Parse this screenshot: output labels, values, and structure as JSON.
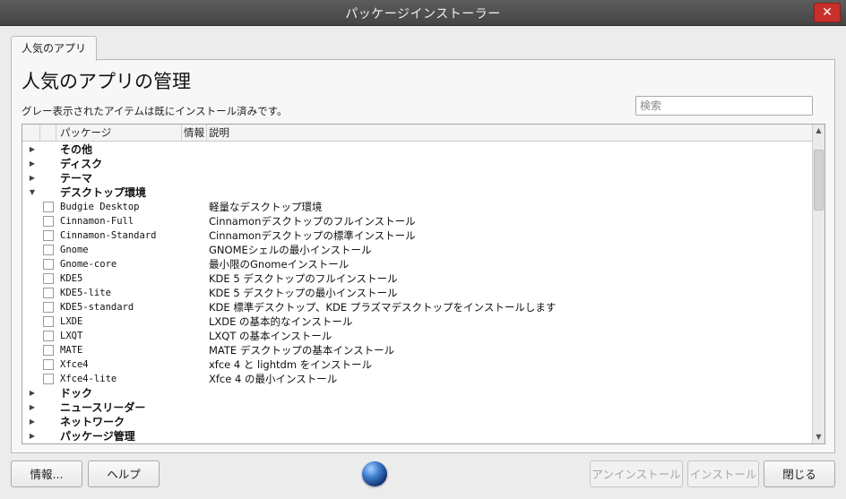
{
  "window": {
    "title": "パッケージインストーラー",
    "close_label": "✕"
  },
  "tab": {
    "label": "人気のアプリ"
  },
  "main": {
    "heading": "人気のアプリの管理",
    "subtext": "グレー表示されたアイテムは既にインストール済みです。",
    "search_placeholder": "検索"
  },
  "table": {
    "columns": [
      "パッケージ",
      "情報",
      "説明"
    ],
    "rows": [
      {
        "type": "category",
        "label": "その他",
        "expanded": false
      },
      {
        "type": "category",
        "label": "ディスク",
        "expanded": false
      },
      {
        "type": "category",
        "label": "テーマ",
        "expanded": false
      },
      {
        "type": "category",
        "label": "デスクトップ環境",
        "expanded": true
      },
      {
        "type": "package",
        "name": "Budgie Desktop",
        "desc": "軽量なデスクトップ環境",
        "checked": false
      },
      {
        "type": "package",
        "name": "Cinnamon-Full",
        "desc": "Cinnamonデスクトップのフルインストール",
        "checked": false
      },
      {
        "type": "package",
        "name": "Cinnamon-Standard",
        "desc": "Cinnamonデスクトップの標準インストール",
        "checked": false
      },
      {
        "type": "package",
        "name": "Gnome",
        "desc": "GNOMEシェルの最小インストール",
        "checked": false
      },
      {
        "type": "package",
        "name": "Gnome-core",
        "desc": "最小限のGnomeインストール",
        "checked": false
      },
      {
        "type": "package",
        "name": "KDE5",
        "desc": "KDE 5 デスクトップのフルインストール",
        "checked": false
      },
      {
        "type": "package",
        "name": "KDE5-lite",
        "desc": "KDE 5 デスクトップの最小インストール",
        "checked": false
      },
      {
        "type": "package",
        "name": "KDE5-standard",
        "desc": "KDE 標準デスクトップ、KDE プラズマデスクトップをインストールします",
        "checked": false
      },
      {
        "type": "package",
        "name": "LXDE",
        "desc": "LXDE の基本的なインストール",
        "checked": false
      },
      {
        "type": "package",
        "name": "LXQT",
        "desc": "LXQT の基本インストール",
        "checked": false
      },
      {
        "type": "package",
        "name": "MATE",
        "desc": "MATE デスクトップの基本インストール",
        "checked": false
      },
      {
        "type": "package",
        "name": "Xfce4",
        "desc": "xfce 4 と lightdm をインストール",
        "checked": false
      },
      {
        "type": "package",
        "name": "Xfce4-lite",
        "desc": "Xfce 4 の最小インストール",
        "checked": false
      },
      {
        "type": "category",
        "label": "ドック",
        "expanded": false
      },
      {
        "type": "category",
        "label": "ニュースリーダー",
        "expanded": false
      },
      {
        "type": "category",
        "label": "ネットワーク",
        "expanded": false
      },
      {
        "type": "category",
        "label": "パッケージ管理",
        "expanded": false
      }
    ]
  },
  "buttons": {
    "info": "情報...",
    "help": "ヘルプ",
    "uninstall": "アンインストール",
    "install": "インストール",
    "close": "閉じる"
  },
  "icons": {
    "expander_collapsed": "triangle-right-icon",
    "expander_expanded": "triangle-down-icon",
    "globe": "globe-icon"
  }
}
